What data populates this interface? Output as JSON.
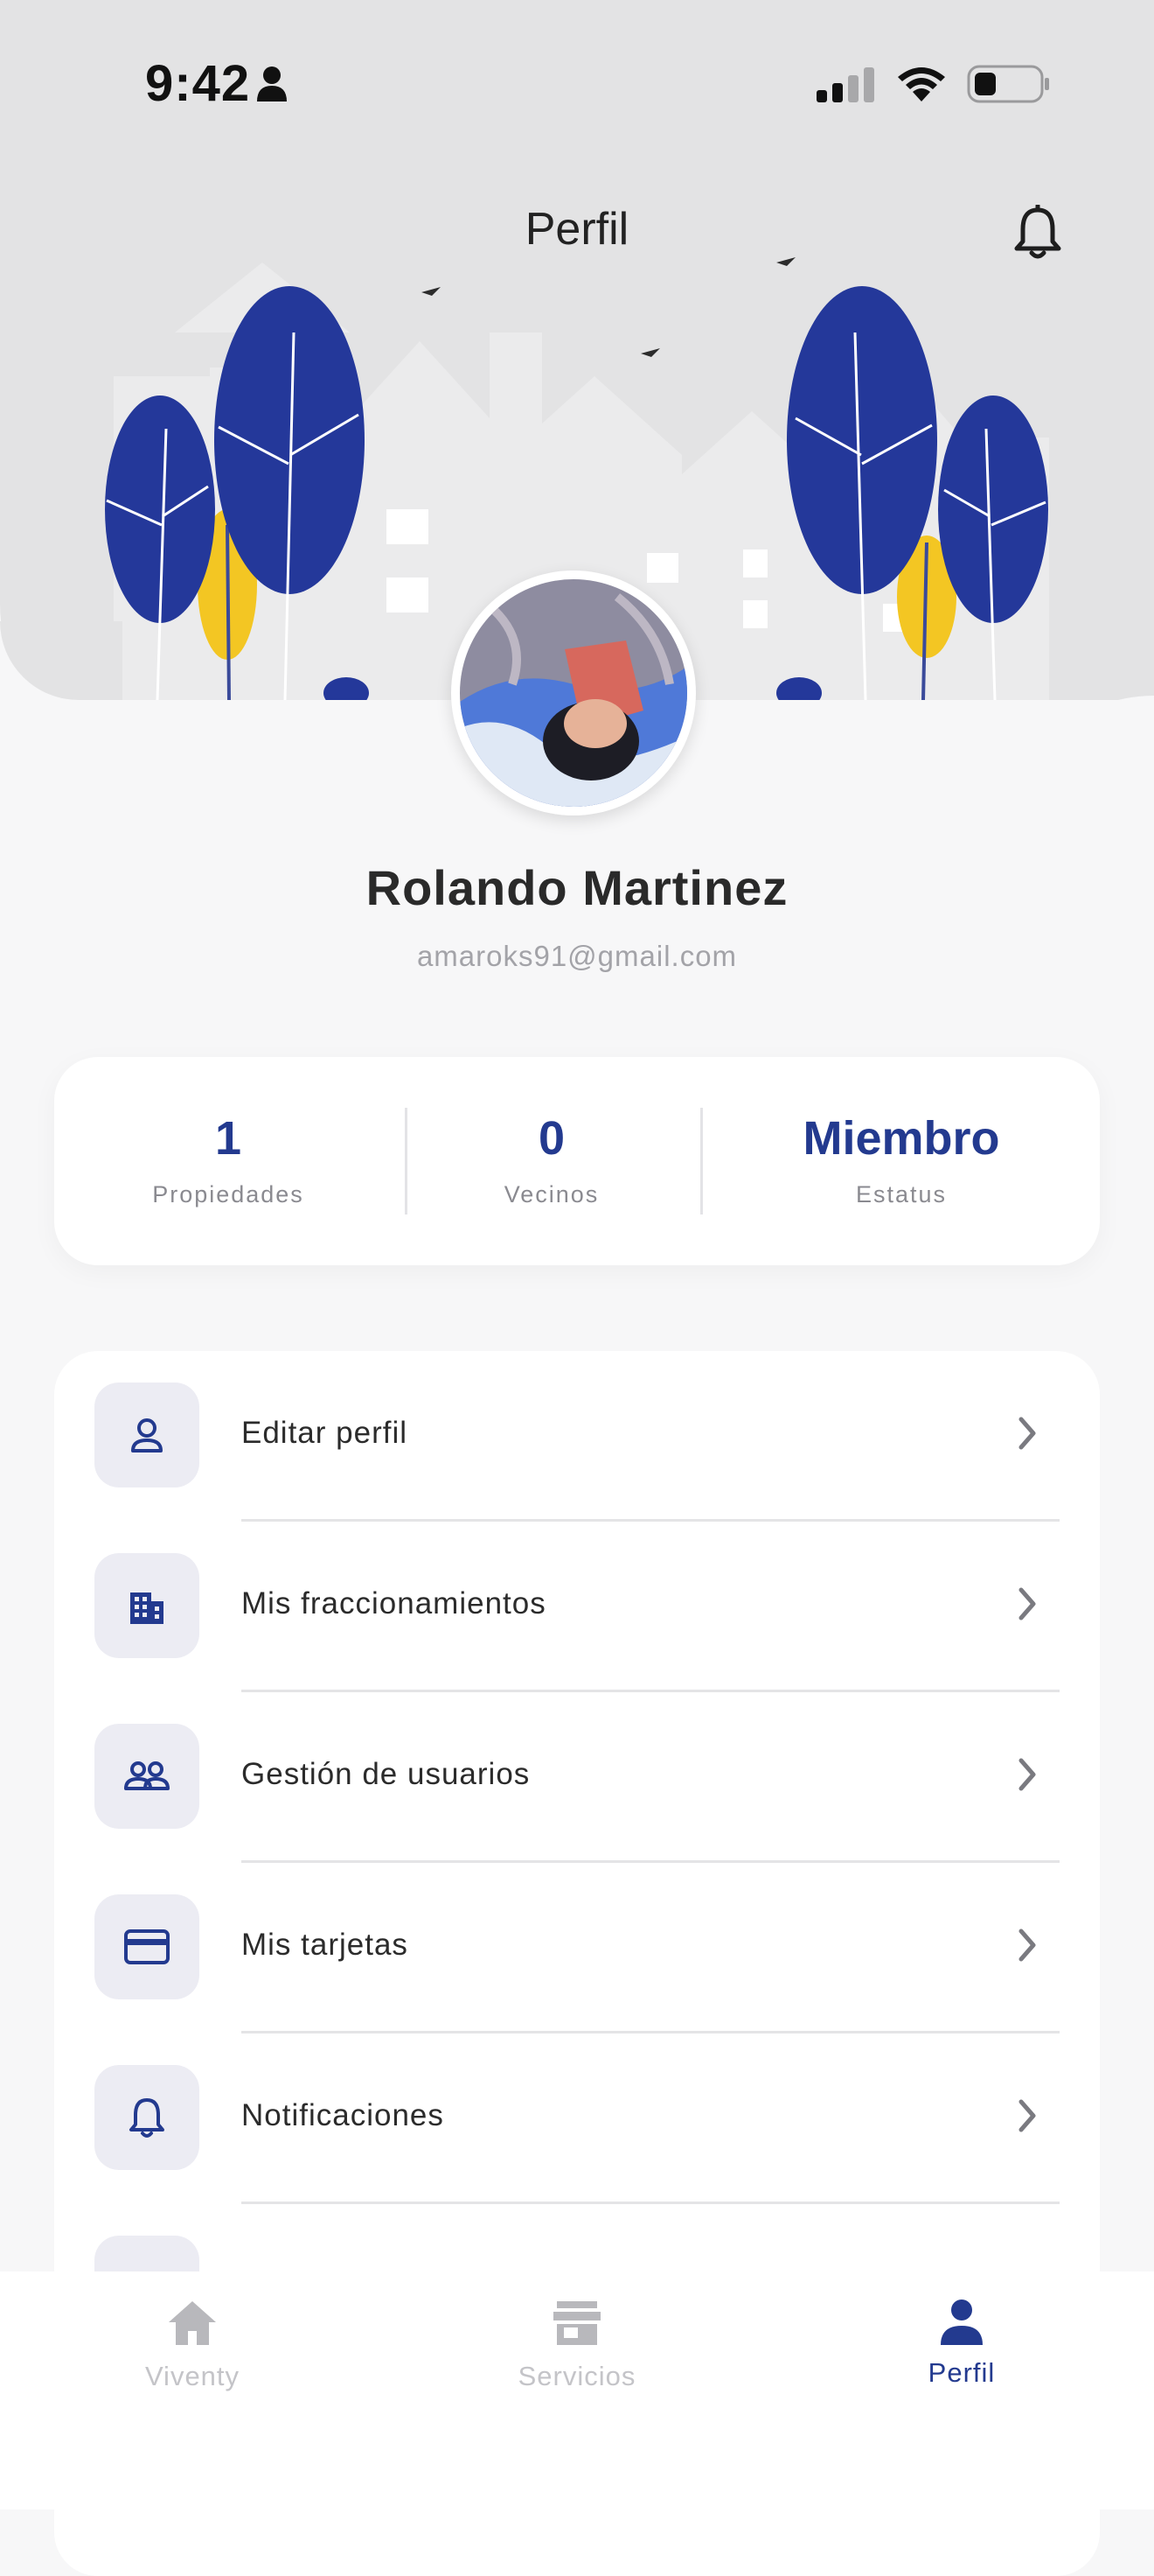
{
  "status_bar": {
    "time": "9:42"
  },
  "header": {
    "title": "Perfil"
  },
  "user": {
    "name": "Rolando Martinez",
    "email": "amaroks91@gmail.com"
  },
  "stats": [
    {
      "value": "1",
      "label": "Propiedades"
    },
    {
      "value": "0",
      "label": "Vecinos"
    },
    {
      "value": "Miembro",
      "label": "Estatus"
    }
  ],
  "menu": [
    {
      "label": "Editar perfil",
      "icon": "user-icon"
    },
    {
      "label": "Mis fraccionamientos",
      "icon": "building-icon"
    },
    {
      "label": "Gestión de usuarios",
      "icon": "users-icon"
    },
    {
      "label": "Mis tarjetas",
      "icon": "credit-card-icon"
    },
    {
      "label": "Notificaciones",
      "icon": "bell-icon"
    }
  ],
  "tabs": [
    {
      "label": "Viventy",
      "icon": "home-icon",
      "active": false
    },
    {
      "label": "Servicios",
      "icon": "store-icon",
      "active": false
    },
    {
      "label": "Perfil",
      "icon": "person-icon",
      "active": true
    }
  ],
  "colors": {
    "accent": "#233a8f",
    "tree_blue": "#24389a",
    "tree_yellow": "#f3c623",
    "hero_bg": "#e3e3e4",
    "page_bg": "#f7f7f8",
    "inactive_tab": "#b8b8bc"
  }
}
